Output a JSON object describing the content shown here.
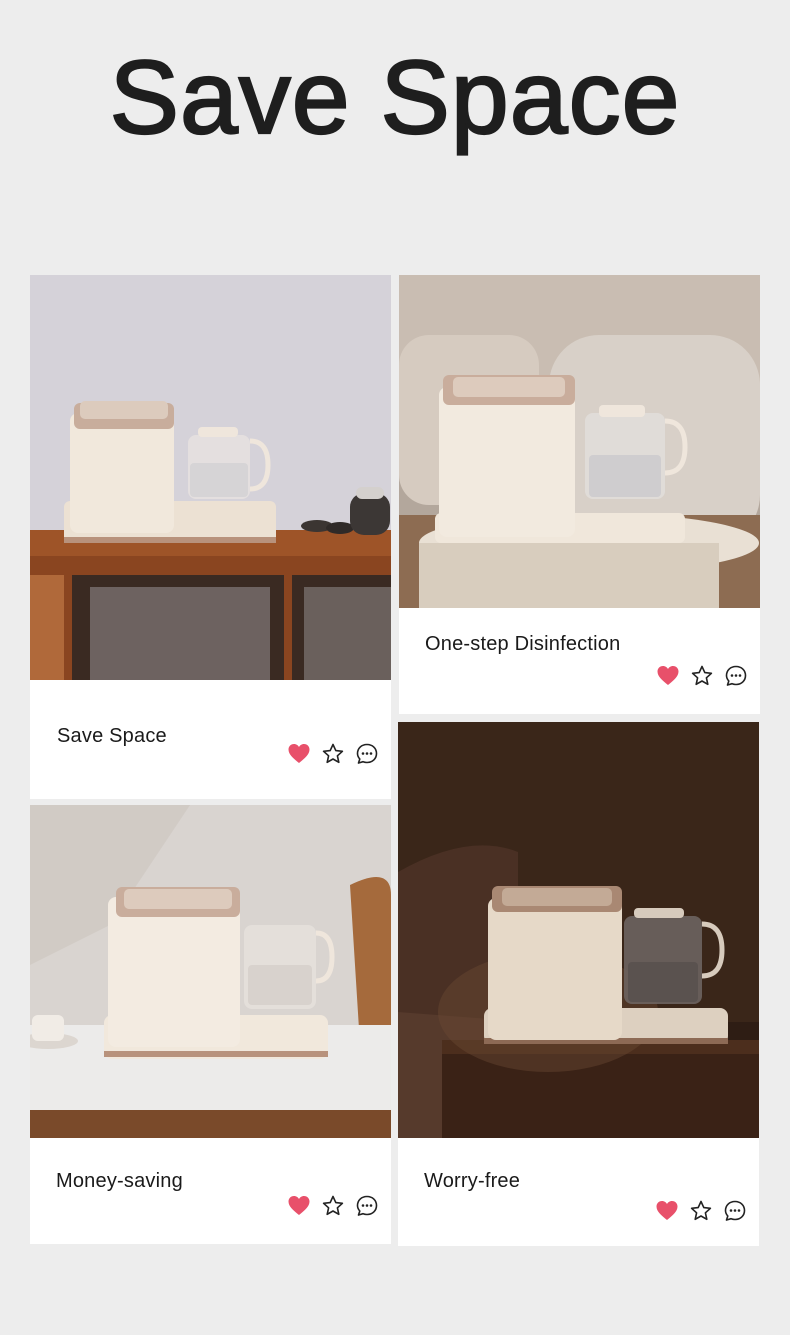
{
  "page": {
    "title": "Save Space"
  },
  "colors": {
    "heart": "#e8506a",
    "background": "#ededed",
    "card": "#ffffff",
    "text": "#1a1a1a"
  },
  "cards": [
    {
      "caption": "Save Space",
      "actions": [
        "heart-icon",
        "star-icon",
        "comment-icon"
      ]
    },
    {
      "caption": "One-step Disinfection",
      "actions": [
        "heart-icon",
        "star-icon",
        "comment-icon"
      ]
    },
    {
      "caption": "Money-saving",
      "actions": [
        "heart-icon",
        "star-icon",
        "comment-icon"
      ]
    },
    {
      "caption": "Worry-free",
      "actions": [
        "heart-icon",
        "star-icon",
        "comment-icon"
      ]
    }
  ]
}
